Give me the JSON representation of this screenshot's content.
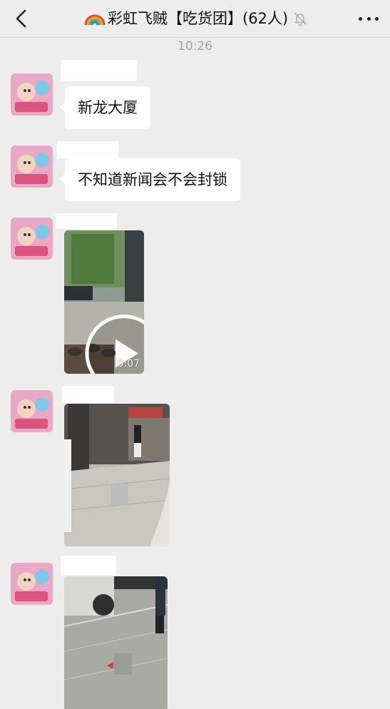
{
  "header": {
    "title": "彩虹飞贼【吃货团】(62人)",
    "back_icon": "chevron-left-icon",
    "mute_icon": "bell-off-icon",
    "more_icon": "more-dots-icon"
  },
  "timestamp": "10:26",
  "messages": [
    {
      "type": "text",
      "text": "新龙大厦"
    },
    {
      "type": "text",
      "text": "不知道新闻会不会封锁"
    },
    {
      "type": "video",
      "duration": "0:07"
    },
    {
      "type": "image"
    },
    {
      "type": "image"
    }
  ],
  "colors": {
    "background": "#ededed",
    "bubble": "#ffffff",
    "timestamp": "#a0a0a0"
  }
}
